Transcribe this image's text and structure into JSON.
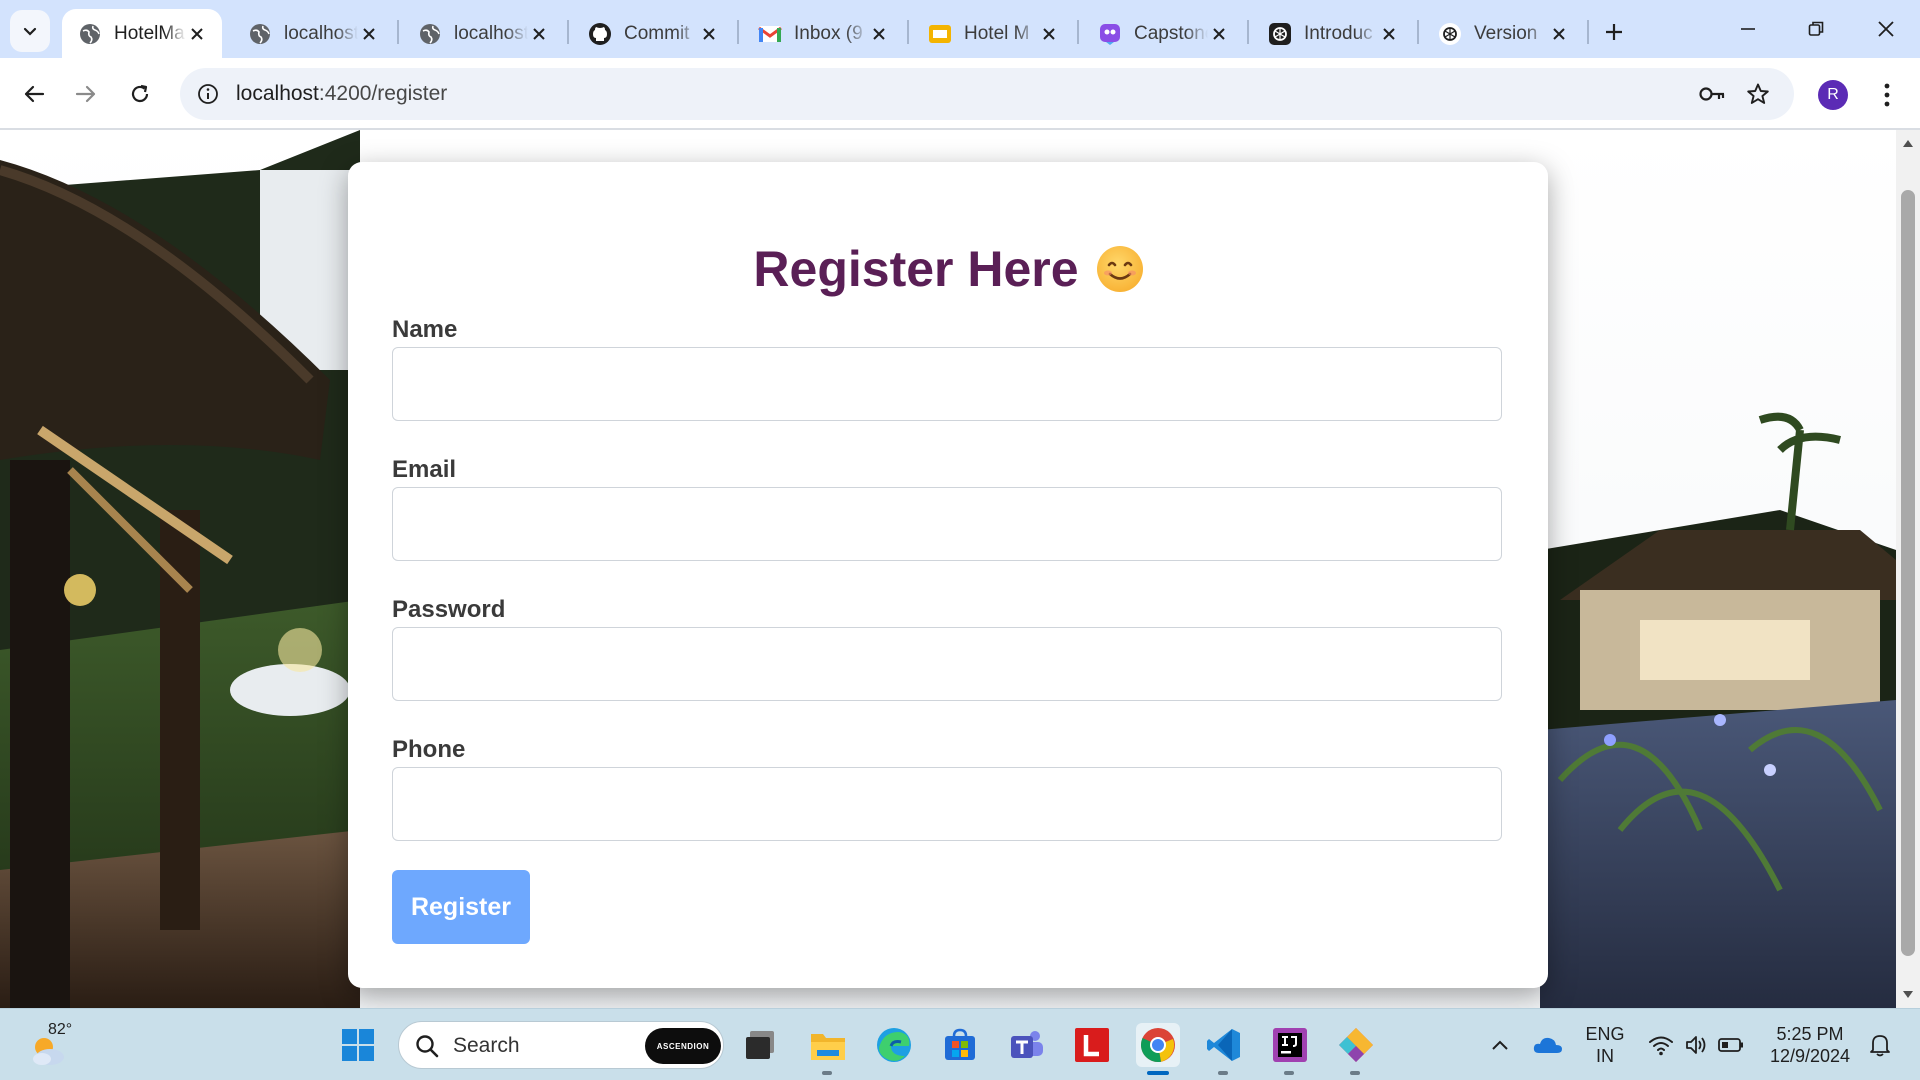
{
  "browser": {
    "tabs": [
      {
        "title": "HotelMa",
        "favicon": "globe-icon",
        "active": true
      },
      {
        "title": "localhost",
        "favicon": "globe-icon",
        "active": false
      },
      {
        "title": "localhost",
        "favicon": "globe-icon",
        "active": false
      },
      {
        "title": "Commit",
        "favicon": "github-icon",
        "active": false
      },
      {
        "title": "Inbox (9",
        "favicon": "gmail-icon",
        "active": false
      },
      {
        "title": "Hotel M",
        "favicon": "slides-icon",
        "active": false
      },
      {
        "title": "Capstone",
        "favicon": "copilot-icon",
        "active": false
      },
      {
        "title": "Introduc",
        "favicon": "chatgpt-icon",
        "active": false
      },
      {
        "title": "Version",
        "favicon": "chatgpt-icon",
        "active": false
      }
    ],
    "url_host": "localhost",
    "url_path": ":4200/register",
    "profile_initial": "R"
  },
  "form": {
    "title": "Register Here",
    "title_emoji": "smiling-face-icon",
    "fields": [
      {
        "label": "Name",
        "value": "",
        "type": "text"
      },
      {
        "label": "Email",
        "value": "",
        "type": "email"
      },
      {
        "label": "Password",
        "value": "",
        "type": "password"
      },
      {
        "label": "Phone",
        "value": "",
        "type": "tel"
      }
    ],
    "submit_label": "Register"
  },
  "taskbar": {
    "weather_temp": "82°",
    "search_label": "Search",
    "search_badge": "ASCENDION",
    "lang_line1": "ENG",
    "lang_line2": "IN",
    "time": "5:25 PM",
    "date": "12/9/2024",
    "pinned": [
      "windows-start-icon",
      "task-view-icon",
      "file-explorer-icon",
      "edge-icon",
      "store-icon",
      "teams-icon",
      "l-app-icon",
      "chrome-icon",
      "vscode-icon",
      "intellij-icon",
      "git-app-icon"
    ]
  },
  "colors": {
    "title": "#5a1f56",
    "button": "#6ea8fe",
    "tabstrip": "#d3e3fd",
    "taskbar": "#c9dfea"
  }
}
